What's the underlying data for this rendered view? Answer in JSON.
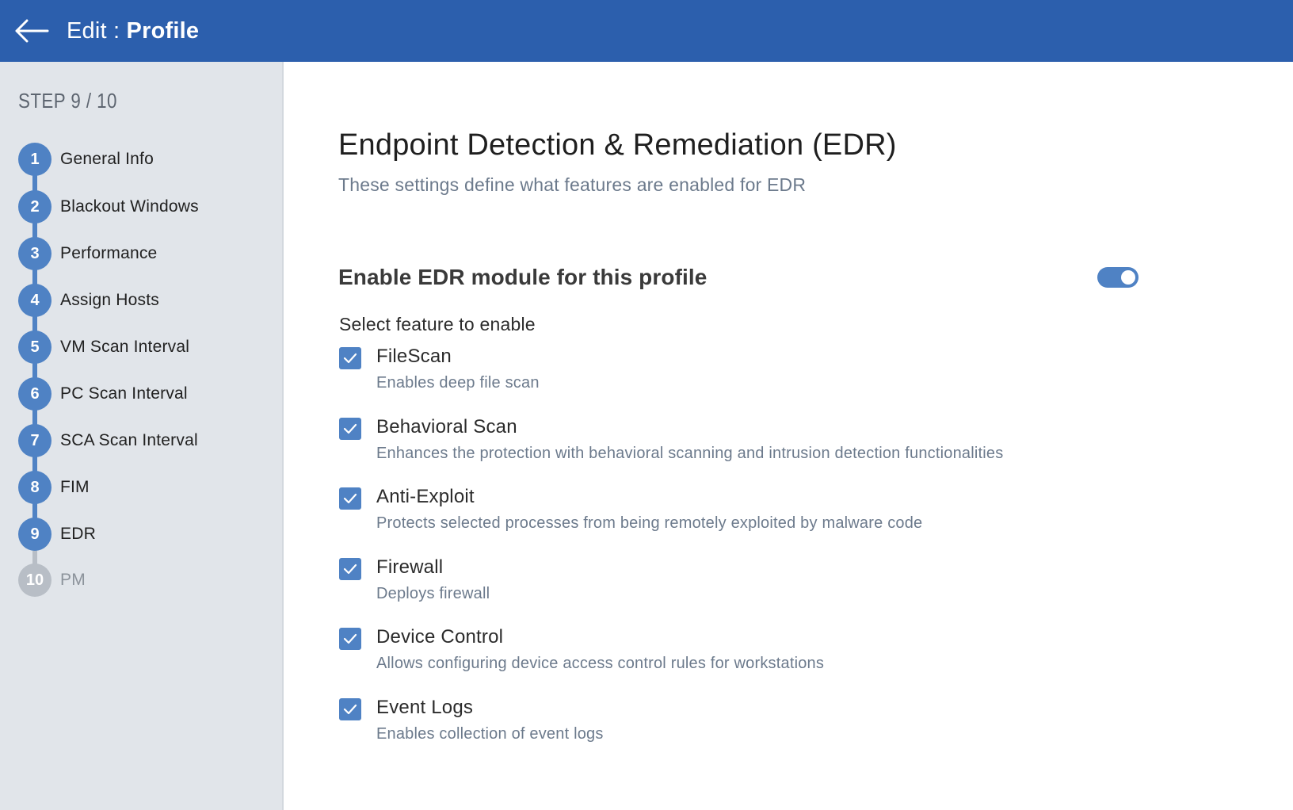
{
  "header": {
    "title_prefix": "Edit : ",
    "title_name": "Profile",
    "background": "#2c5fad"
  },
  "sidebar": {
    "step_counter": "STEP 9 / 10",
    "steps": [
      {
        "number": "1",
        "label": "General Info",
        "state": "completed"
      },
      {
        "number": "2",
        "label": "Blackout Windows",
        "state": "completed"
      },
      {
        "number": "3",
        "label": "Performance",
        "state": "completed"
      },
      {
        "number": "4",
        "label": "Assign Hosts",
        "state": "completed"
      },
      {
        "number": "5",
        "label": "VM Scan Interval",
        "state": "completed"
      },
      {
        "number": "6",
        "label": "PC Scan Interval",
        "state": "completed"
      },
      {
        "number": "7",
        "label": "SCA Scan Interval",
        "state": "completed"
      },
      {
        "number": "8",
        "label": "FIM",
        "state": "completed"
      },
      {
        "number": "9",
        "label": "EDR",
        "state": "current"
      },
      {
        "number": "10",
        "label": "PM",
        "state": "upcoming"
      }
    ],
    "active_color": "#4f82c4",
    "inactive_color": "#b8bec6"
  },
  "main": {
    "title": "Endpoint Detection & Remediation (EDR)",
    "subtitle": "These settings define what features are enabled for EDR",
    "enable_label": "Enable EDR module for this profile",
    "enable_on": true,
    "select_heading": "Select feature to enable",
    "features": [
      {
        "name": "FileScan",
        "description": "Enables deep file scan",
        "checked": true
      },
      {
        "name": "Behavioral Scan",
        "description": "Enhances the protection with behavioral scanning and intrusion detection functionalities",
        "checked": true
      },
      {
        "name": "Anti-Exploit",
        "description": "Protects selected processes from being remotely exploited by malware code",
        "checked": true
      },
      {
        "name": "Firewall",
        "description": "Deploys firewall",
        "checked": true
      },
      {
        "name": "Device Control",
        "description": "Allows configuring device access control rules for workstations",
        "checked": true
      },
      {
        "name": "Event Logs",
        "description": "Enables collection of event logs",
        "checked": true
      }
    ]
  }
}
